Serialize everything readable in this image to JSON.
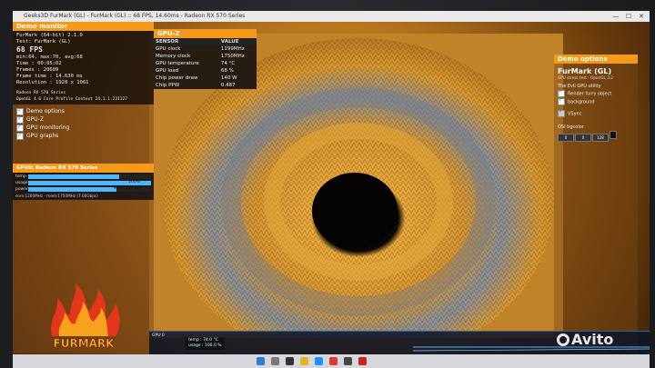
{
  "window": {
    "title": "Geeks3D FurMark (GL) - FurMark (GL) :: 68 FPS, 14.60ms - Radeon RX 570 Series"
  },
  "left_panel": {
    "header": "Demo monitor",
    "lines": [
      "FurMark (64-bit) 2.1.0",
      "Test: FurMark (GL)"
    ],
    "fps": "68 FPS",
    "stats": "min:64, max:70, avg:68",
    "rows": [
      "Time     : 00:05:02",
      "Frames   : 20689",
      "Frame time : 14.630 ms",
      "Resolution : 1920 x 1061"
    ],
    "gpu_lines": [
      "Radeon RX 570 Series",
      "OpenGL 4.6 Core Profile Context 24.1.1.231127"
    ],
    "options": [
      "Demo options",
      "GPU-Z",
      "GPU monitoring",
      "GPU graphs"
    ]
  },
  "gpu_panel": {
    "header": "GPU0: Radeon RX 570 Series",
    "bars": [
      {
        "label": "temp",
        "value": "74°C",
        "fill": 0.74
      },
      {
        "label": "usage",
        "value": "100%",
        "fill": 1.0
      },
      {
        "label": "power",
        "value": "99.1 [127 W]",
        "fill": 0.72
      }
    ],
    "footer": "core:1200MHz - mem:1750MHz (7.00Gbps)"
  },
  "logo": {
    "text": "FURMARK"
  },
  "gpuz": {
    "header": "GPU-Z",
    "columns": [
      "SENSOR",
      "VALUE"
    ],
    "rows": [
      [
        "GPU clock",
        "1199MHz"
      ],
      [
        "Memory clock",
        "1750MHz"
      ],
      [
        "GPU temperature",
        "74 °C"
      ],
      [
        "GPU load",
        "68 %"
      ],
      [
        "Chip power draw",
        "140 W"
      ],
      [
        "Chip PPW",
        "0.487"
      ]
    ]
  },
  "right_panel": {
    "header": "Demo options",
    "title": "FurMark (GL)",
    "subtitle": "GPU stress test - OpenGL 3.2",
    "section": "The Evil GPU utility",
    "options": [
      "Render furry object",
      "background",
      "VSync"
    ],
    "bgcolor_label": "OSI bgcolor",
    "swatches": [
      "0",
      "0",
      "128"
    ]
  },
  "graph": {
    "label": "GPU 0",
    "legend": [
      "temp : 74.0 °C",
      "usage : 100.0 %"
    ]
  },
  "watermark": {
    "text": "Avito"
  },
  "colors": {
    "accent": "#f39a1b",
    "bar": "#4db6ff"
  }
}
